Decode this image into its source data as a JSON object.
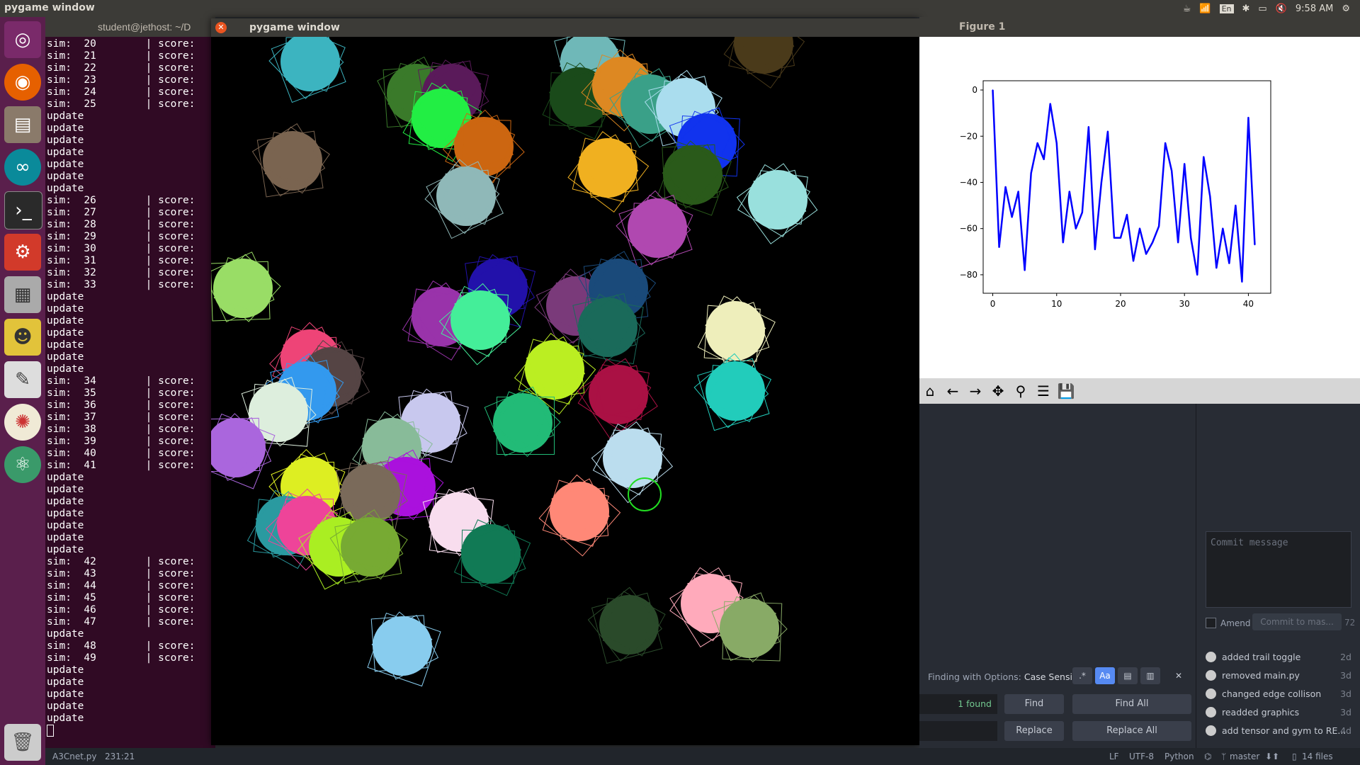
{
  "topbar": {
    "title": "pygame window",
    "tray_items": [
      "☕",
      "wifi",
      "En",
      "✱",
      "battery",
      "🔇",
      "⚙"
    ],
    "time": "9:58 AM"
  },
  "launcher": {
    "items": [
      "ubuntu-icon",
      "firefox-icon",
      "files-icon",
      "arduino-icon",
      "terminal-icon",
      "settings-icon",
      "workspace-icon",
      "pidgin-icon",
      "text-editor-icon",
      "compass-icon",
      "atom-icon"
    ],
    "trash": "trash-icon"
  },
  "terminal": {
    "title": "student@jethost: ~/D",
    "lines": [
      "sim:  20        | score:",
      "sim:  21        | score:",
      "sim:  22        | score:",
      "sim:  23        | score:",
      "sim:  24        | score:",
      "sim:  25        | score:",
      "update",
      "update",
      "update",
      "update",
      "update",
      "update",
      "update",
      "sim:  26        | score:",
      "sim:  27        | score:",
      "sim:  28        | score:",
      "sim:  29        | score:",
      "sim:  30        | score:",
      "sim:  31        | score:",
      "sim:  32        | score:",
      "sim:  33        | score:",
      "update",
      "update",
      "update",
      "update",
      "update",
      "update",
      "update",
      "sim:  34        | score:",
      "sim:  35        | score:",
      "sim:  36        | score:",
      "sim:  37        | score:",
      "sim:  38        | score:",
      "sim:  39        | score:",
      "sim:  40        | score:",
      "sim:  41        | score:",
      "update",
      "update",
      "update",
      "update",
      "update",
      "update",
      "update",
      "sim:  42        | score:",
      "sim:  43        | score:",
      "sim:  44        | score:",
      "sim:  45        | score:",
      "sim:  46        | score:",
      "sim:  47        | score:",
      "update",
      "sim:  48        | score:",
      "sim:  49        | score:",
      "update",
      "update",
      "update",
      "update",
      "update"
    ]
  },
  "pygame": {
    "title": "pygame window",
    "blobs": [
      {
        "color": "#3cb4c0",
        "x": 140,
        "y": 35
      },
      {
        "color": "#3a7a2a",
        "x": 290,
        "y": 80
      },
      {
        "color": "#5a1a5a",
        "x": 340,
        "y": 80
      },
      {
        "color": "#22ee44",
        "x": 325,
        "y": 115
      },
      {
        "color": "#cc6611",
        "x": 385,
        "y": 155
      },
      {
        "color": "#8fb8b8",
        "x": 360,
        "y": 225
      },
      {
        "color": "#7a6450",
        "x": 115,
        "y": 175
      },
      {
        "color": "#6fb8b8",
        "x": 535,
        "y": 35
      },
      {
        "color": "#1a4a1a",
        "x": 520,
        "y": 85
      },
      {
        "color": "#dd8822",
        "x": 580,
        "y": 70
      },
      {
        "color": "#3aa088",
        "x": 620,
        "y": 95
      },
      {
        "color": "#aaddee",
        "x": 670,
        "y": 100
      },
      {
        "color": "#1133ee",
        "x": 700,
        "y": 150
      },
      {
        "color": "#2a5a1a",
        "x": 680,
        "y": 195
      },
      {
        "color": "#f0b020",
        "x": 560,
        "y": 185
      },
      {
        "color": "#99e0dd",
        "x": 800,
        "y": 230
      },
      {
        "color": "#b048b0",
        "x": 630,
        "y": 270
      },
      {
        "color": "#99dd66",
        "x": 45,
        "y": 355
      },
      {
        "color": "#2211aa",
        "x": 405,
        "y": 355
      },
      {
        "color": "#9933aa",
        "x": 325,
        "y": 395
      },
      {
        "color": "#44ee99",
        "x": 380,
        "y": 400
      },
      {
        "color": "#7a3a7a",
        "x": 515,
        "y": 380
      },
      {
        "color": "#1a4a7a",
        "x": 575,
        "y": 355
      },
      {
        "color": "#1a6a5a",
        "x": 560,
        "y": 410
      },
      {
        "color": "#eeeebb",
        "x": 740,
        "y": 415
      },
      {
        "color": "#ee4477",
        "x": 140,
        "y": 455
      },
      {
        "color": "#554444",
        "x": 170,
        "y": 480
      },
      {
        "color": "#3399ee",
        "x": 135,
        "y": 500
      },
      {
        "color": "#ddeedd",
        "x": 95,
        "y": 530
      },
      {
        "color": "#aa66dd",
        "x": 35,
        "y": 580
      },
      {
        "color": "#bbee22",
        "x": 485,
        "y": 470
      },
      {
        "color": "#aa1144",
        "x": 575,
        "y": 505
      },
      {
        "color": "#22ccbb",
        "x": 740,
        "y": 500
      },
      {
        "color": "#22bb77",
        "x": 440,
        "y": 545
      },
      {
        "color": "#c8c8ee",
        "x": 310,
        "y": 545
      },
      {
        "color": "#88bb99",
        "x": 255,
        "y": 580
      },
      {
        "color": "#bbddee",
        "x": 595,
        "y": 595
      },
      {
        "color": "#ddee22",
        "x": 140,
        "y": 635
      },
      {
        "color": "#aa11dd",
        "x": 275,
        "y": 635
      },
      {
        "color": "#7a6a5a",
        "x": 225,
        "y": 645
      },
      {
        "color": "#2a9aa0",
        "x": 105,
        "y": 690
      },
      {
        "color": "#ee4499",
        "x": 135,
        "y": 690
      },
      {
        "color": "#aaee22",
        "x": 180,
        "y": 720
      },
      {
        "color": "#77aa33",
        "x": 225,
        "y": 720
      },
      {
        "color": "#f8ddee",
        "x": 350,
        "y": 685
      },
      {
        "color": "#117a55",
        "x": 395,
        "y": 730
      },
      {
        "color": "#ff8877",
        "x": 520,
        "y": 670
      },
      {
        "color": "#ffaabb",
        "x": 705,
        "y": 800
      },
      {
        "color": "#2a4a2a",
        "x": 590,
        "y": 830
      },
      {
        "color": "#88aa66",
        "x": 760,
        "y": 835
      },
      {
        "color": "#88ccee",
        "x": 270,
        "y": 860
      },
      {
        "color": "#4a3a1a",
        "x": 780,
        "y": 10
      }
    ],
    "ring": {
      "color": "#22dd22",
      "x": 612,
      "y": 646
    }
  },
  "figure": {
    "title": "Figure 1",
    "toolbar": [
      "home-icon",
      "back-icon",
      "forward-icon",
      "pan-icon",
      "zoom-icon",
      "configure-icon",
      "save-icon"
    ]
  },
  "chart_data": {
    "type": "line",
    "title": "",
    "xlabel": "",
    "ylabel": "",
    "xlim": [
      -1.5,
      43.5
    ],
    "ylim": [
      -88,
      4
    ],
    "xticks": [
      0,
      10,
      20,
      30,
      40
    ],
    "yticks": [
      0,
      -20,
      -40,
      -60,
      -80
    ],
    "series": [
      {
        "color": "#0000ff",
        "x": [
          0,
          1,
          2,
          3,
          4,
          5,
          6,
          7,
          8,
          9,
          10,
          11,
          12,
          13,
          14,
          15,
          16,
          17,
          18,
          19,
          20,
          21,
          22,
          23,
          24,
          25,
          26,
          27,
          28,
          29,
          30,
          31,
          32,
          33,
          34,
          35,
          36,
          37,
          38,
          39,
          40,
          41
        ],
        "values": [
          0,
          -68,
          -42,
          -55,
          -44,
          -78,
          -36,
          -23,
          -30,
          -6,
          -23,
          -66,
          -44,
          -60,
          -53,
          -16,
          -69,
          -40,
          -18,
          -64,
          -64,
          -54,
          -74,
          -60,
          -71,
          -66,
          -59,
          -23,
          -35,
          -66,
          -32,
          -64,
          -80,
          -29,
          -46,
          -77,
          -60,
          -75,
          -50,
          -83,
          -12,
          -67
        ]
      }
    ]
  },
  "editor": {
    "commit_placeholder": "Commit message",
    "amend_label": "Amend",
    "commit_button": "Commit to mas...",
    "commit_count": "72",
    "commits": [
      {
        "message": "added trail toggle",
        "age": "2d"
      },
      {
        "message": "removed main.py",
        "age": "3d"
      },
      {
        "message": "changed edge collison",
        "age": "3d"
      },
      {
        "message": "readded graphics",
        "age": "3d"
      },
      {
        "message": "add tensor and gym to RE...",
        "age": "4d"
      }
    ],
    "find": {
      "options_prefix": "Finding with Options:",
      "options_value": "Case Sensitive",
      "found": "1 found",
      "find_btn": "Find",
      "find_all_btn": "Find All",
      "replace_btn": "Replace",
      "replace_all_btn": "Replace All",
      "regex": ".*",
      "case": "Aa",
      "close": "✕"
    }
  },
  "statusbar": {
    "file": "A3Cnet.py",
    "cursor": "231:21",
    "line_ending": "LF",
    "encoding": "UTF-8",
    "grammar": "Python",
    "branch": "master",
    "files": "14 files"
  }
}
